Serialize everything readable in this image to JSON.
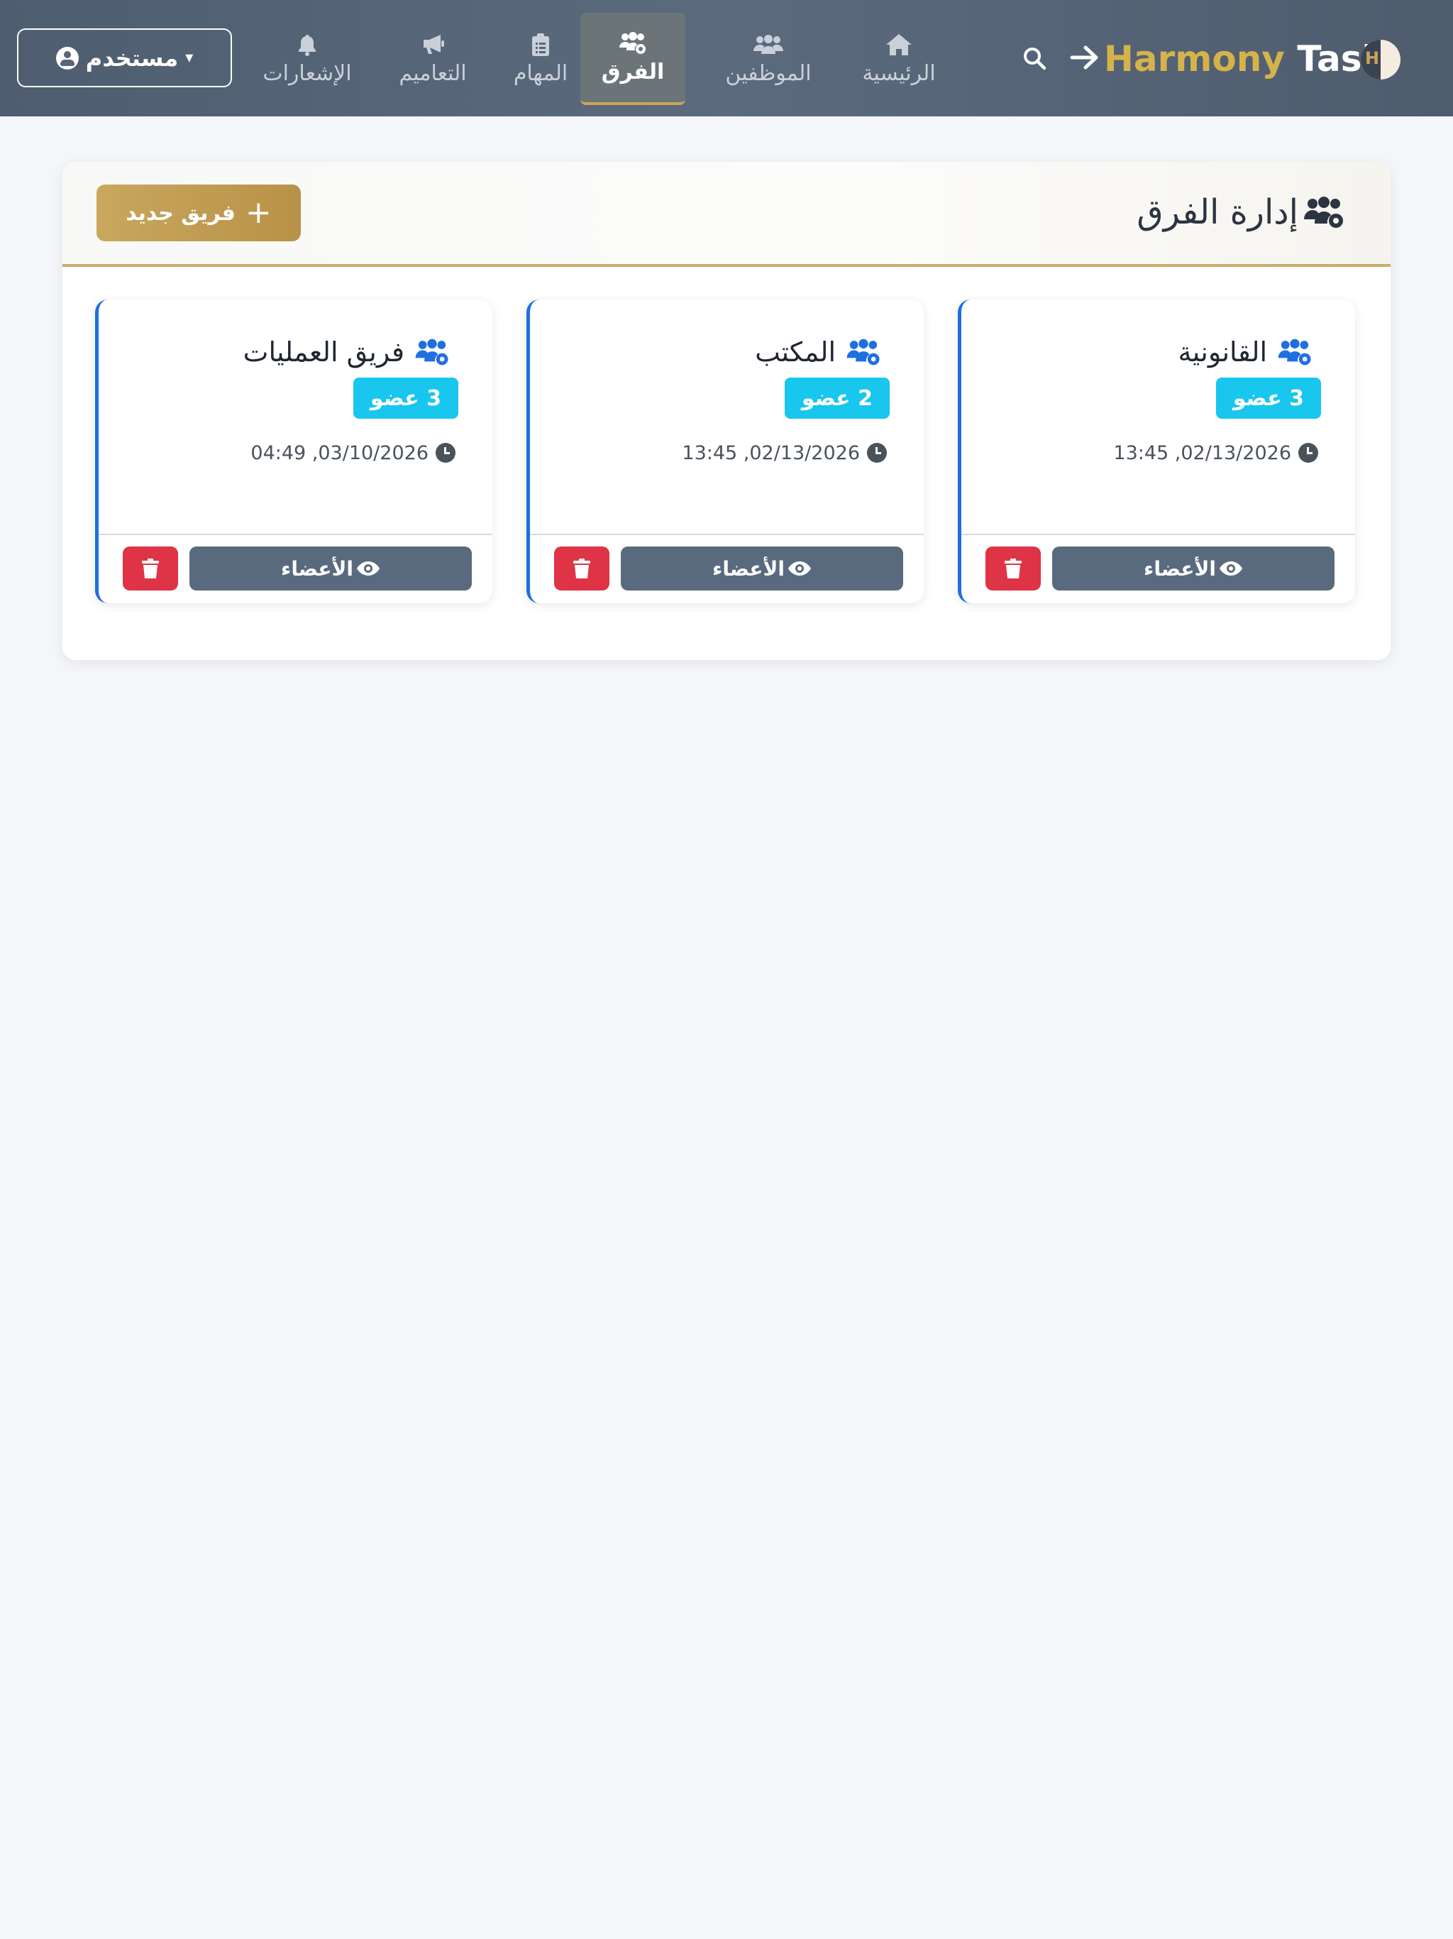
{
  "navbar": {
    "brand_part1": "Harmony",
    "brand_part2": "Task",
    "logo_letter": "H",
    "user_menu_label": "مستخدم",
    "items": [
      {
        "label": "الرئيسية",
        "icon": "home-icon",
        "active": false
      },
      {
        "label": "الموظفين",
        "icon": "users-icon",
        "active": false
      },
      {
        "label": "الفرق",
        "icon": "users-gear-icon",
        "active": true
      },
      {
        "label": "المهام",
        "icon": "clipboard-list-icon",
        "active": false
      },
      {
        "label": "التعاميم",
        "icon": "bullhorn-icon",
        "active": false
      },
      {
        "label": "الإشعارات",
        "icon": "bell-icon",
        "active": false
      }
    ]
  },
  "page": {
    "title": "إدارة الفرق",
    "new_team_label": "فريق جديد"
  },
  "teams": [
    {
      "name": "القانونية",
      "members": "3 عضو",
      "date": "02/13/2026, 13:45",
      "members_button": "الأعضاء"
    },
    {
      "name": "المكتب",
      "members": "2 عضو",
      "date": "02/13/2026, 13:45",
      "members_button": "الأعضاء"
    },
    {
      "name": "فريق العمليات",
      "members": "3 عضو",
      "date": "03/10/2026, 04:49",
      "members_button": "الأعضاء"
    }
  ],
  "colors": {
    "navbar": "#566578",
    "brand_gold": "#d6b24b",
    "accent_gold": "#c9a75e",
    "card_border": "#1f6fe0",
    "badge": "#18c6ee",
    "members_button": "#5a6a7e",
    "delete_button": "#de3445",
    "team_icon": "#1f6fe0"
  }
}
